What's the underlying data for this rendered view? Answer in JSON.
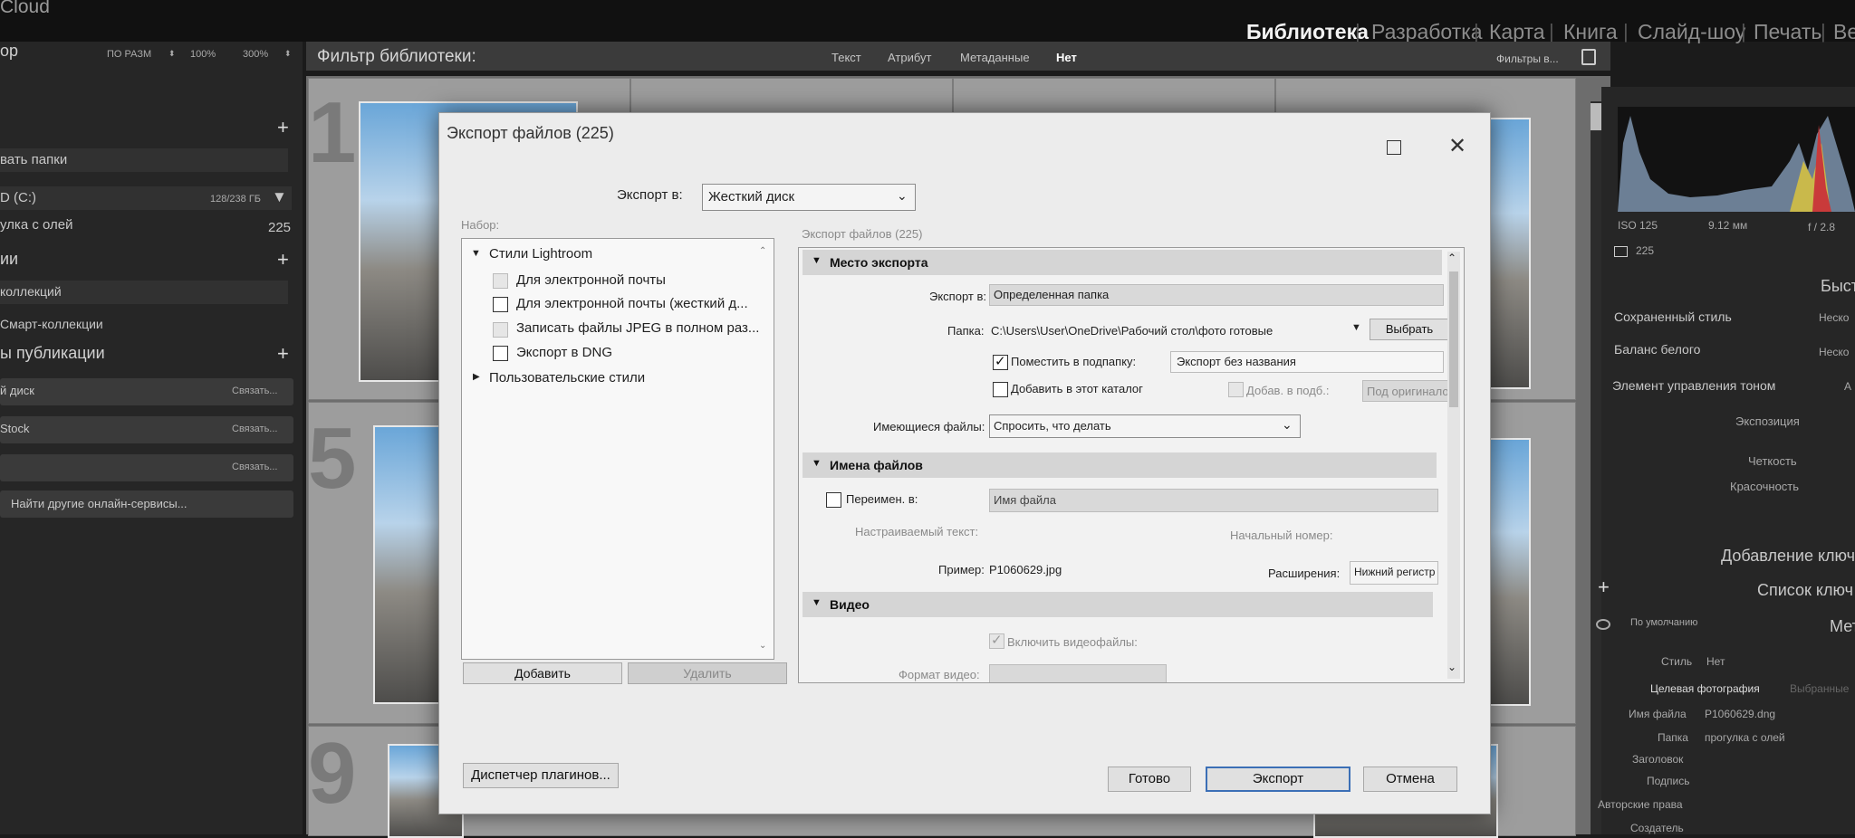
{
  "app": {
    "brand": "Cloud",
    "modules": [
      "Библиотека",
      "Разработка",
      "Карта",
      "Книга",
      "Слайд-шоу",
      "Печать",
      "Ве"
    ]
  },
  "left_panel": {
    "header_partial": "ор",
    "zoom": [
      "ПО РАЗМ",
      "100%",
      "300%"
    ],
    "add_folder": "вать папки",
    "drive": {
      "name": "D (C:)",
      "space": "128/238 ГБ"
    },
    "folder": {
      "name": "улка с олей",
      "count": "225"
    },
    "collections_title": "ии",
    "collections": [
      "коллекций",
      "Смарт-коллекции"
    ],
    "publish_title": "ы публикации",
    "publish_services": [
      {
        "name": "й диск",
        "action": "Связать..."
      },
      {
        "name": "Stock",
        "action": "Связать..."
      },
      {
        "name": "",
        "action": "Связать..."
      }
    ],
    "find_more": "Найти другие онлайн-сервисы..."
  },
  "filter_bar": {
    "title": "Фильтр библиотеки:",
    "options": [
      "Текст",
      "Атрибут",
      "Метаданные",
      "Нет"
    ],
    "active": "Нет",
    "presets": "Фильтры в..."
  },
  "grid": {
    "cell_numbers": [
      "1",
      "5",
      "9"
    ]
  },
  "right_panel": {
    "metadata": {
      "iso": "ISO 125",
      "focal": "9.12 мм",
      "aperture": "f / 2.8",
      "count": "225"
    },
    "quick_develop_title": "Быстра",
    "quick_develop": [
      {
        "label": "Сохраненный стиль",
        "value": "Неско"
      },
      {
        "label": "Баланс белого",
        "value": "Неско"
      },
      {
        "label": "Элемент управления тоном",
        "value": "А"
      }
    ],
    "tone_items": [
      "Экспозиция",
      "Четкость",
      "Красочность"
    ],
    "keywords_title": "Добавление ключ",
    "keyword_list_title": "Список ключ",
    "preset_default": "По умолчанию",
    "metadata_title": "Мет",
    "style": {
      "label": "Стиль",
      "value": "Нет"
    },
    "target_tabs": [
      "Целевая фотография",
      "Выбранные"
    ],
    "fields": [
      {
        "label": "Имя файла",
        "value": "P1060629.dng"
      },
      {
        "label": "Папка",
        "value": "прогулка с олей"
      },
      {
        "label": "Заголовок",
        "value": ""
      },
      {
        "label": "Подпись",
        "value": ""
      },
      {
        "label": "Авторские права",
        "value": ""
      },
      {
        "label": "Создатель",
        "value": ""
      }
    ]
  },
  "dialog": {
    "title": "Экспорт файлов (225)",
    "export_to_label": "Экспорт в:",
    "export_to_value": "Жесткий диск",
    "presets_label": "Набор:",
    "presets_group": "Стили Lightroom",
    "presets": [
      {
        "label": "Для электронной почты",
        "checked": false,
        "enabled": false
      },
      {
        "label": "Для электронной почты (жесткий д...",
        "checked": false,
        "enabled": true
      },
      {
        "label": "Записать файлы JPEG в полном раз...",
        "checked": false,
        "enabled": false
      },
      {
        "label": "Экспорт в DNG",
        "checked": false,
        "enabled": true
      }
    ],
    "user_presets": "Пользовательские стили",
    "add_button": "Добавить",
    "remove_button": "Удалить",
    "settings_title": "Экспорт файлов (225)",
    "location": {
      "section": "Место экспорта",
      "export_to_label": "Экспорт в:",
      "export_to_value": "Определенная папка",
      "folder_label": "Папка:",
      "folder_path": "C:\\Users\\User\\OneDrive\\Рабочий стол\\фото готовые",
      "choose_button": "Выбрать",
      "subfolder_label": "Поместить в подпапку:",
      "subfolder_checked": true,
      "subfolder_value": "Экспорт без названия",
      "add_catalog_label": "Добавить в этот каталог",
      "add_stack_label": "Добав. в подб.:",
      "stack_value": "Под оригиналом",
      "existing_label": "Имеющиеся файлы:",
      "existing_value": "Спросить, что делать"
    },
    "naming": {
      "section": "Имена файлов",
      "rename_label": "Переимен. в:",
      "rename_value": "Имя файла",
      "custom_text_label": "Настраиваемый текст:",
      "start_number_label": "Начальный номер:",
      "example_label": "Пример:",
      "example_value": "P1060629.jpg",
      "extensions_label": "Расширения:",
      "extensions_value": "Нижний регистр"
    },
    "video": {
      "section": "Видео",
      "include_label": "Включить видеофайлы:",
      "format_label": "Формат видео:"
    },
    "plugin_manager": "Диспетчер плагинов...",
    "done": "Готово",
    "export": "Экспорт",
    "cancel": "Отмена"
  }
}
